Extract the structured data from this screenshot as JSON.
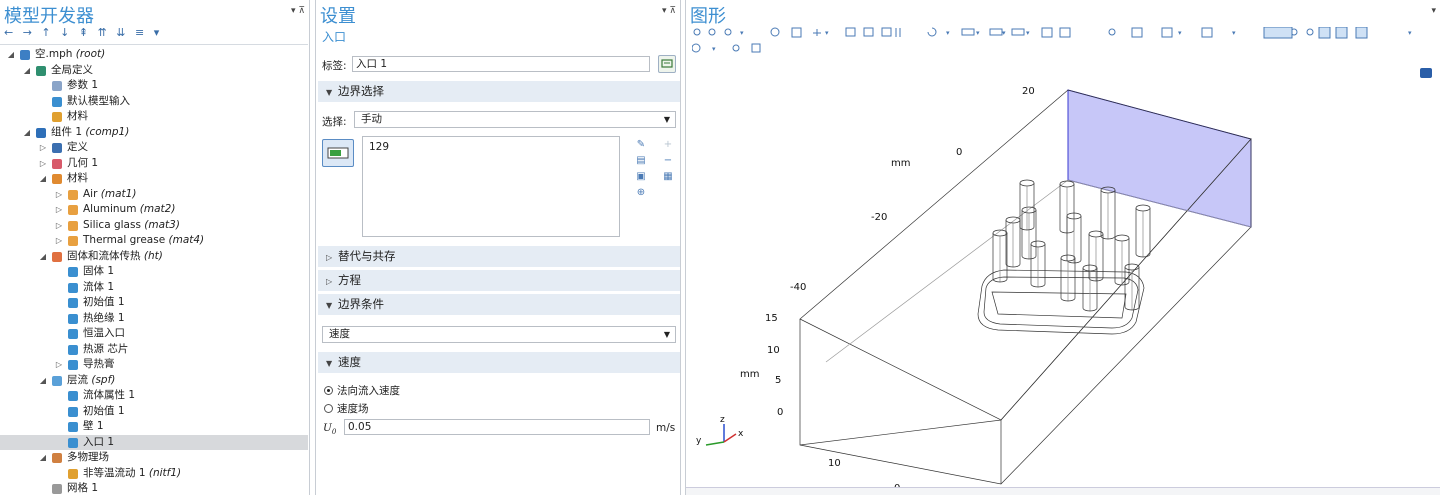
{
  "left": {
    "title": "模型开发器",
    "controls": "▾ ⊼",
    "nav": "← → ↑ ↓ ⇞ ⇈ ⇊ ≡ ▾",
    "tree": [
      {
        "indent": 0,
        "twisty": "◢",
        "icon": "#3d7fc4",
        "label": "空.mph",
        "tag": "(root)"
      },
      {
        "indent": 1,
        "twisty": "◢",
        "icon": "#2f8f6f",
        "label": "全局定义",
        "tag": ""
      },
      {
        "indent": 2,
        "twisty": "",
        "icon": "#8aa4c8",
        "label": "参数 1",
        "tag": ""
      },
      {
        "indent": 2,
        "twisty": "",
        "icon": "#3a8fd0",
        "label": "默认模型输入",
        "tag": ""
      },
      {
        "indent": 2,
        "twisty": "",
        "icon": "#e0a030",
        "label": "材料",
        "tag": ""
      },
      {
        "indent": 1,
        "twisty": "◢",
        "icon": "#2e6fb8",
        "label": "组件 1",
        "tag": "(comp1)"
      },
      {
        "indent": 2,
        "twisty": "▷",
        "icon": "#3b6fb0",
        "label": "定义",
        "tag": ""
      },
      {
        "indent": 2,
        "twisty": "▷",
        "icon": "#d85a6a",
        "label": "几何 1",
        "tag": ""
      },
      {
        "indent": 2,
        "twisty": "◢",
        "icon": "#e08a30",
        "label": "材料",
        "tag": ""
      },
      {
        "indent": 3,
        "twisty": "▷",
        "icon": "#e8a040",
        "label": "Air",
        "tag": "(mat1)"
      },
      {
        "indent": 3,
        "twisty": "▷",
        "icon": "#e8a040",
        "label": "Aluminum",
        "tag": "(mat2)"
      },
      {
        "indent": 3,
        "twisty": "▷",
        "icon": "#e8a040",
        "label": "Silica glass",
        "tag": "(mat3)"
      },
      {
        "indent": 3,
        "twisty": "▷",
        "icon": "#e8a040",
        "label": "Thermal grease",
        "tag": "(mat4)"
      },
      {
        "indent": 2,
        "twisty": "◢",
        "icon": "#e07040",
        "label": "固体和流体传热",
        "tag": "(ht)"
      },
      {
        "indent": 3,
        "twisty": "",
        "icon": "#3a8fd0",
        "label": "固体 1",
        "tag": ""
      },
      {
        "indent": 3,
        "twisty": "",
        "icon": "#3a8fd0",
        "label": "流体 1",
        "tag": ""
      },
      {
        "indent": 3,
        "twisty": "",
        "icon": "#3a8fd0",
        "label": "初始值 1",
        "tag": ""
      },
      {
        "indent": 3,
        "twisty": "",
        "icon": "#3a8fd0",
        "label": "热绝缘 1",
        "tag": ""
      },
      {
        "indent": 3,
        "twisty": "",
        "icon": "#3a8fd0",
        "label": "恒温入口",
        "tag": ""
      },
      {
        "indent": 3,
        "twisty": "",
        "icon": "#3a8fd0",
        "label": "热源 芯片",
        "tag": ""
      },
      {
        "indent": 3,
        "twisty": "▷",
        "icon": "#3a8fd0",
        "label": "导热膏",
        "tag": ""
      },
      {
        "indent": 2,
        "twisty": "◢",
        "icon": "#5aa0d8",
        "label": "层流",
        "tag": "(spf)"
      },
      {
        "indent": 3,
        "twisty": "",
        "icon": "#3a8fd0",
        "label": "流体属性 1",
        "tag": ""
      },
      {
        "indent": 3,
        "twisty": "",
        "icon": "#3a8fd0",
        "label": "初始值 1",
        "tag": ""
      },
      {
        "indent": 3,
        "twisty": "",
        "icon": "#3a8fd0",
        "label": "壁 1",
        "tag": ""
      },
      {
        "indent": 3,
        "twisty": "",
        "icon": "#3a8fd0",
        "label": "入口 1",
        "tag": "",
        "selected": true
      },
      {
        "indent": 2,
        "twisty": "◢",
        "icon": "#d08040",
        "label": "多物理场",
        "tag": ""
      },
      {
        "indent": 3,
        "twisty": "",
        "icon": "#e0a030",
        "label": "非等温流动 1",
        "tag": "(nitf1)"
      },
      {
        "indent": 2,
        "twisty": "",
        "icon": "#999999",
        "label": "网格 1",
        "tag": ""
      }
    ]
  },
  "settings": {
    "title": "设置",
    "controls": "▾ ⊼",
    "subtitle": "入口",
    "label_caption": "标签:",
    "label_value": "入口 1",
    "sec_boundary": "边界选择",
    "selection_caption": "选择:",
    "selection_value": "手动",
    "selection_list": "129",
    "sec_override": "替代与共存",
    "sec_equation": "方程",
    "sec_bc": "边界条件",
    "bc_value": "速度",
    "sec_velocity": "速度",
    "radio1": "法向流入速度",
    "radio2": "速度场",
    "u0_label": "U",
    "u0_sub": "0",
    "u0_value": "0.05",
    "u0_unit": "m/s"
  },
  "graphics": {
    "title": "图形",
    "controls": "▾",
    "labels": {
      "t20": "20",
      "t0": "0",
      "tm20": "-20",
      "tm40": "-40",
      "mm1": "mm",
      "z15": "15",
      "z10": "10",
      "z5": "5",
      "z0": "0",
      "mm2": "mm",
      "b10": "10",
      "b0": "0"
    },
    "axis": {
      "x": "x",
      "y": "y",
      "z": "z"
    }
  }
}
